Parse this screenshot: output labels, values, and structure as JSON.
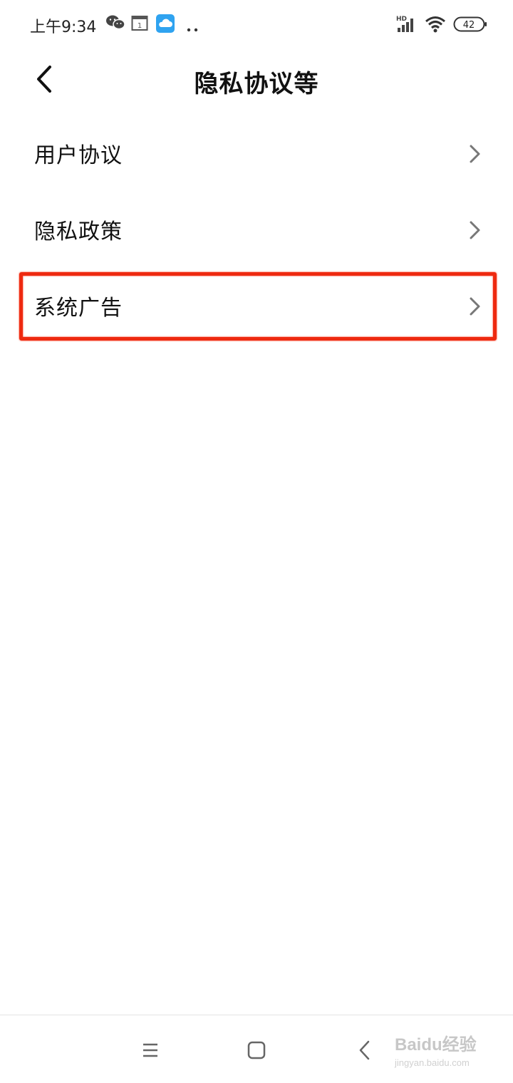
{
  "status_bar": {
    "time": "上午9:34",
    "calendar_day": "1",
    "network_label": "HD",
    "battery": "42",
    "icons": [
      "wechat-icon",
      "calendar-icon",
      "cloud-icon",
      "more-dots-icon",
      "signal-icon",
      "wifi-icon",
      "battery-icon"
    ]
  },
  "header": {
    "title": "隐私协议等",
    "back_icon": "chevron-left-icon"
  },
  "menu": {
    "items": [
      {
        "label": "用户协议",
        "icon": "chevron-right-icon"
      },
      {
        "label": "隐私政策",
        "icon": "chevron-right-icon"
      },
      {
        "label": "系统广告",
        "icon": "chevron-right-icon",
        "highlighted": true
      }
    ]
  },
  "annotation": {
    "highlight_color": "#ee2a10"
  },
  "nav_bar": {
    "buttons": [
      "menu-icon",
      "home-icon",
      "back-icon"
    ]
  },
  "watermark": {
    "text": "Baidu经验",
    "url": "jingyan.baidu.com"
  }
}
